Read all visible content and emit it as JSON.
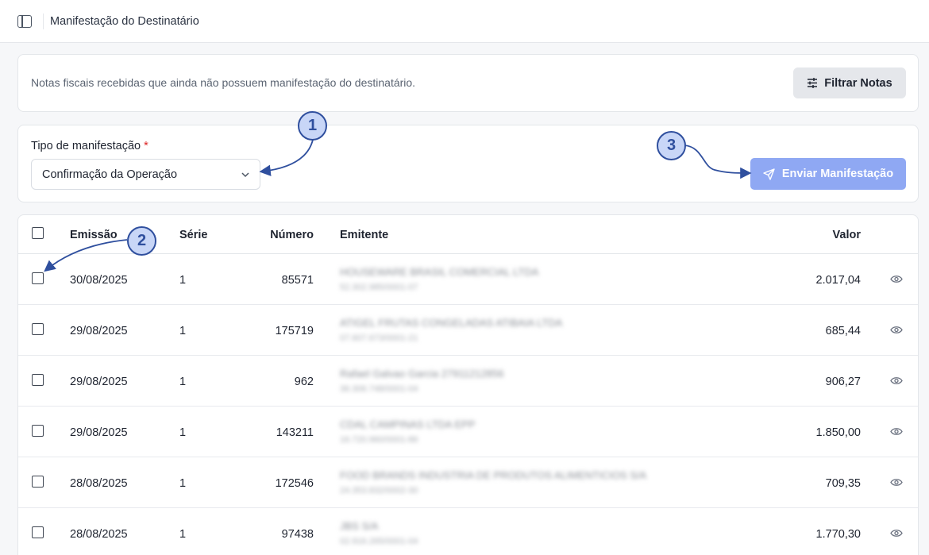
{
  "header": {
    "title": "Manifestação do Destinatário",
    "sidebar_toggle_icon": "sidebar-panel-icon"
  },
  "info": {
    "description": "Notas fiscais recebidas que ainda não possuem manifestação do destinatário.",
    "filter_label": "Filtrar Notas",
    "filter_icon": "sliders-icon"
  },
  "manifest": {
    "label": "Tipo de manifestação",
    "required_mark": "*",
    "selected": "Confirmação da Operação",
    "send_label": "Enviar Manifestação",
    "send_icon": "send-icon",
    "send_color": "#8fa8f3"
  },
  "table": {
    "columns": {
      "emissao": "Emissão",
      "serie": "Série",
      "numero": "Número",
      "emitente": "Emitente",
      "valor": "Valor"
    },
    "rows": [
      {
        "emissao": "30/08/2025",
        "serie": "1",
        "numero": "85571",
        "emitente": "HOUSEWARE BRASIL COMERCIAL LTDA",
        "doc": "52.302.985/0001-07",
        "valor": "2.017,04"
      },
      {
        "emissao": "29/08/2025",
        "serie": "1",
        "numero": "175719",
        "emitente": "ATIGEL FRUTAS CONGELADAS ATIBAIA LTDA",
        "doc": "07.607.673/0001-21",
        "valor": "685,44"
      },
      {
        "emissao": "29/08/2025",
        "serie": "1",
        "numero": "962",
        "emitente": "Rafael Galvao Garcia 27911212856",
        "doc": "36.306.748/0001-04",
        "valor": "906,27"
      },
      {
        "emissao": "29/08/2025",
        "serie": "1",
        "numero": "143211",
        "emitente": "CDAL CAMPINAS LTDA EPP",
        "doc": "16.720.960/0001-86",
        "valor": "1.850,00"
      },
      {
        "emissao": "28/08/2025",
        "serie": "1",
        "numero": "172546",
        "emitente": "FOOD BRANDS INDUSTRIA DE PRODUTOS ALIMENTICIOS S/A",
        "doc": "24.353.832/0002-30",
        "valor": "709,35"
      },
      {
        "emissao": "28/08/2025",
        "serie": "1",
        "numero": "97438",
        "emitente": "JBS S/A",
        "doc": "02.916.265/0001-04",
        "valor": "1.770,30"
      }
    ]
  },
  "annotations": {
    "m1": "1",
    "m2": "2",
    "m3": "3",
    "color": "#2f4f9e"
  }
}
